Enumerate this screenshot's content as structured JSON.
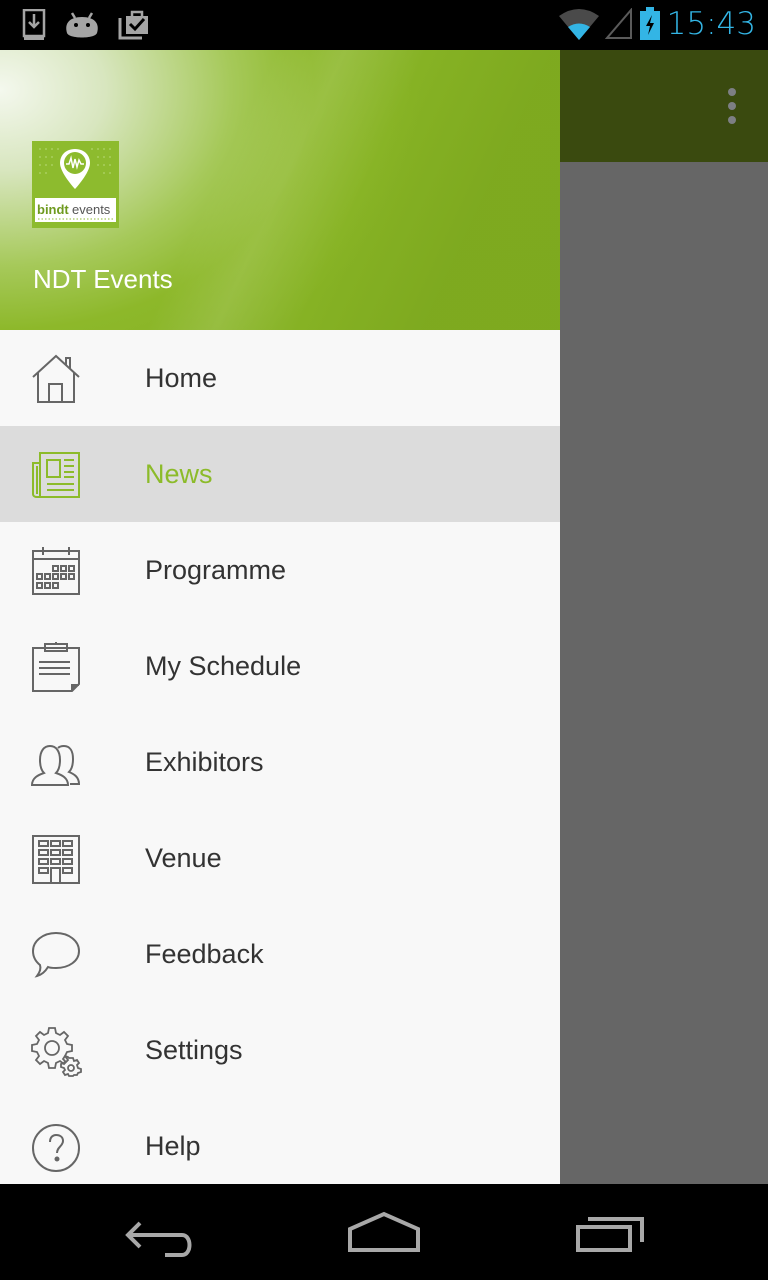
{
  "status_bar": {
    "time": "15:43",
    "left_icons": [
      "download-icon",
      "android-icon",
      "clipboard-check-icon"
    ],
    "right_icons": [
      "wifi-icon",
      "cell-signal-icon",
      "battery-charging-icon"
    ],
    "accent_color": "#33b5e5"
  },
  "app": {
    "actionbar_color": "#3a4a0f",
    "overflow_icon": "overflow-menu-icon"
  },
  "drawer": {
    "header": {
      "logo_text_bold": "bindt",
      "logo_text_light": "events",
      "app_name": "NDT Events"
    },
    "accent_color": "#8cbb2a",
    "items": [
      {
        "label": "Home",
        "icon": "home-icon",
        "active": false
      },
      {
        "label": "News",
        "icon": "newspaper-icon",
        "active": true
      },
      {
        "label": "Programme",
        "icon": "calendar-icon",
        "active": false
      },
      {
        "label": "My Schedule",
        "icon": "clipboard-icon",
        "active": false
      },
      {
        "label": "Exhibitors",
        "icon": "people-icon",
        "active": false
      },
      {
        "label": "Venue",
        "icon": "building-icon",
        "active": false
      },
      {
        "label": "Feedback",
        "icon": "speech-bubble-icon",
        "active": false
      },
      {
        "label": "Settings",
        "icon": "gears-icon",
        "active": false
      },
      {
        "label": "Help",
        "icon": "help-icon",
        "active": false
      }
    ]
  },
  "nav_bar": {
    "buttons": [
      "back-icon",
      "home-nav-icon",
      "recent-apps-icon"
    ]
  }
}
